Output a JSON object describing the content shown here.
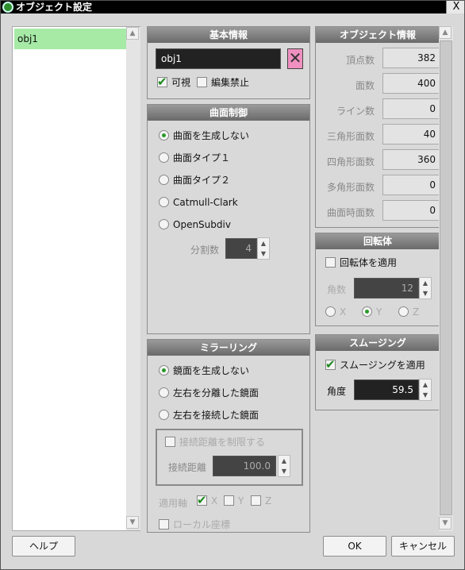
{
  "window": {
    "title": "オブジェクト設定",
    "close_label": "X"
  },
  "object_list": {
    "items": [
      "obj1"
    ]
  },
  "basic": {
    "header": "基本情報",
    "name": "obj1",
    "visible_label": "可視",
    "lock_label": "編集禁止"
  },
  "curve": {
    "header": "曲面制御",
    "options": [
      "曲面を生成しない",
      "曲面タイプ１",
      "曲面タイプ２",
      "Catmull-Clark",
      "OpenSubdiv"
    ],
    "selected": 0,
    "div_label": "分割数",
    "div_value": "4"
  },
  "mirror": {
    "header": "ミラーリング",
    "options": [
      "鏡面を生成しない",
      "左右を分離した鏡面",
      "左右を接続した鏡面"
    ],
    "selected": 0,
    "limit_label": "接続距離を制限する",
    "dist_label": "接続距離",
    "dist_value": "100.0",
    "axis_label": "適用軸",
    "axes": [
      "X",
      "Y",
      "Z"
    ],
    "local_label": "ローカル座標"
  },
  "info": {
    "header": "オブジェクト情報",
    "rows": [
      {
        "label": "頂点数",
        "value": "382"
      },
      {
        "label": "面数",
        "value": "400"
      },
      {
        "label": "ライン数",
        "value": "0"
      },
      {
        "label": "三角形面数",
        "value": "40"
      },
      {
        "label": "四角形面数",
        "value": "360"
      },
      {
        "label": "多角形面数",
        "value": "0"
      },
      {
        "label": "曲面時面数",
        "value": "0"
      }
    ]
  },
  "lathe": {
    "header": "回転体",
    "apply_label": "回転体を適用",
    "angle_label": "角数",
    "angle_value": "12",
    "axes": [
      "X",
      "Y",
      "Z"
    ],
    "selected_axis": 1
  },
  "smoothing": {
    "header": "スムージング",
    "apply_label": "スムージングを適用",
    "angle_label": "角度",
    "angle_value": "59.5"
  },
  "buttons": {
    "help": "ヘルプ",
    "ok": "OK",
    "cancel": "キャンセル"
  },
  "colors": {
    "selection": "#a6eaa6",
    "header": "#7a7a7a",
    "field": "#222222",
    "swatch": "#f090c0"
  }
}
